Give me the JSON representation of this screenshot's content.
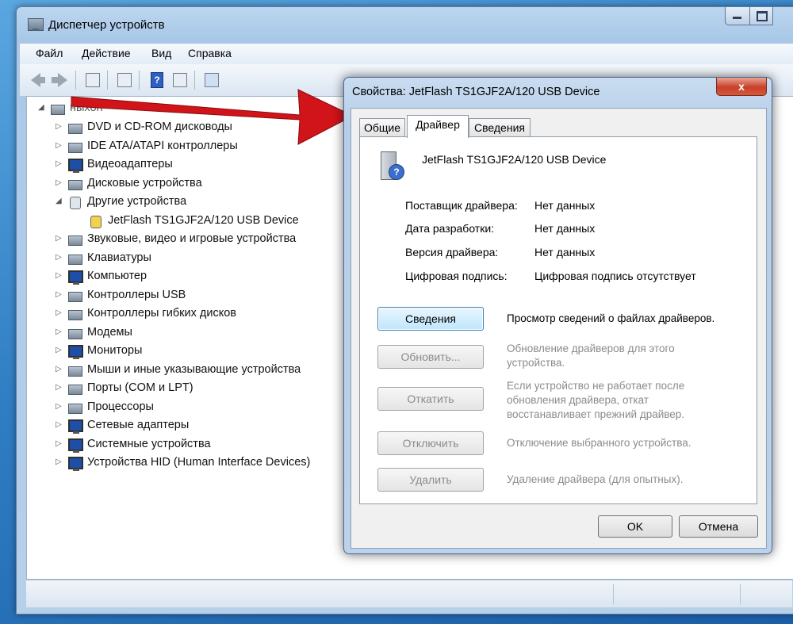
{
  "window": {
    "title": "Диспетчер устройств"
  },
  "menu": [
    "Файл",
    "Действие",
    "Вид",
    "Справка"
  ],
  "toolbar": {
    "icons": [
      "back-icon",
      "forward-icon",
      "show-hide-tree-icon",
      "properties-icon",
      "help-icon",
      "action-pane-icon",
      "scan-hardware-icon"
    ],
    "help_glyph": "?"
  },
  "tree": {
    "root_label": "ныхон",
    "items": [
      {
        "label": "DVD и CD-ROM дисководы",
        "expander": "▷",
        "icon": "dvd-drive-icon"
      },
      {
        "label": "IDE ATA/ATAPI контроллеры",
        "expander": "▷",
        "icon": "ide-controller-icon"
      },
      {
        "label": "Видеоадаптеры",
        "expander": "▷",
        "icon": "display-adapter-icon"
      },
      {
        "label": "Дисковые устройства",
        "expander": "▷",
        "icon": "disk-drive-icon"
      },
      {
        "label": "Другие устройства",
        "expander": "◢",
        "icon": "unknown-device-icon"
      },
      {
        "label": "JetFlash TS1GJF2A/120 USB Device",
        "expander": "",
        "icon": "warning-device-icon"
      },
      {
        "label": "Звуковые, видео и игровые устройства",
        "expander": "▷",
        "icon": "speaker-icon"
      },
      {
        "label": "Клавиатуры",
        "expander": "▷",
        "icon": "keyboard-icon"
      },
      {
        "label": "Компьютер",
        "expander": "▷",
        "icon": "computer-icon"
      },
      {
        "label": "Контроллеры USB",
        "expander": "▷",
        "icon": "usb-icon"
      },
      {
        "label": "Контроллеры гибких дисков",
        "expander": "▷",
        "icon": "floppy-controller-icon"
      },
      {
        "label": "Модемы",
        "expander": "▷",
        "icon": "modem-icon"
      },
      {
        "label": "Мониторы",
        "expander": "▷",
        "icon": "monitor-icon"
      },
      {
        "label": "Мыши и иные указывающие устройства",
        "expander": "▷",
        "icon": "mouse-icon"
      },
      {
        "label": "Порты (COM и LPT)",
        "expander": "▷",
        "icon": "port-icon"
      },
      {
        "label": "Процессоры",
        "expander": "▷",
        "icon": "processor-icon"
      },
      {
        "label": "Сетевые адаптеры",
        "expander": "▷",
        "icon": "network-adapter-icon"
      },
      {
        "label": "Системные устройства",
        "expander": "▷",
        "icon": "system-device-icon"
      },
      {
        "label": "Устройства HID (Human Interface Devices)",
        "expander": "▷",
        "icon": "hid-icon"
      }
    ]
  },
  "dialog": {
    "title": "Свойства: JetFlash TS1GJF2A/120 USB Device",
    "close_glyph": "x",
    "tabs": [
      "Общие",
      "Драйвер",
      "Сведения"
    ],
    "active_tab": "Драйвер",
    "device_name": "JetFlash TS1GJF2A/120 USB Device",
    "device_icon_glyph": "?",
    "properties": [
      {
        "label": "Поставщик драйвера:",
        "value": "Нет данных"
      },
      {
        "label": "Дата разработки:",
        "value": "Нет данных"
      },
      {
        "label": "Версия драйвера:",
        "value": "Нет данных"
      },
      {
        "label": "Цифровая подпись:",
        "value": "Цифровая подпись отсутствует"
      }
    ],
    "actions": [
      {
        "label": "Сведения",
        "desc": "Просмотр сведений о файлах драйверов.",
        "enabled": true
      },
      {
        "label": "Обновить...",
        "desc": "Обновление драйверов для этого устройства.",
        "enabled": false
      },
      {
        "label": "Откатить",
        "desc": "Если устройство не работает после обновления драйвера, откат восстанавливает прежний драйвер.",
        "enabled": false
      },
      {
        "label": "Отключить",
        "desc": "Отключение выбранного устройства.",
        "enabled": false
      },
      {
        "label": "Удалить",
        "desc": "Удаление драйвера (для опытных).",
        "enabled": false
      }
    ],
    "ok_label": "OK",
    "cancel_label": "Отмена"
  },
  "colors": {
    "annotation_arrow": "#d0141a",
    "window_frame": "#bcd6ef",
    "close_button": "#c7402a",
    "active_button": "#bee6fd"
  }
}
